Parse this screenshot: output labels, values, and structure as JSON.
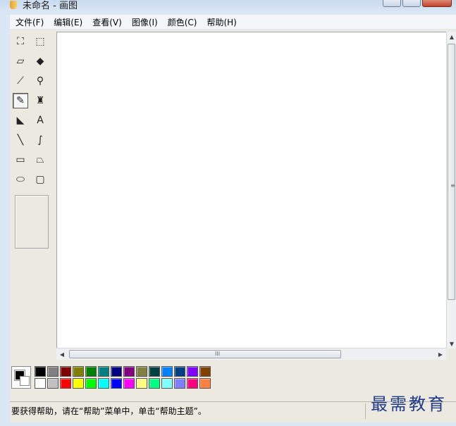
{
  "window": {
    "title": "未命名 - 画图"
  },
  "menu": [
    "文件(F)",
    "编辑(E)",
    "查看(V)",
    "图像(I)",
    "颜色(C)",
    "帮助(H)"
  ],
  "tools": [
    {
      "name": "free-form-select",
      "icon": "free-select-icon",
      "glyph": "⛶"
    },
    {
      "name": "select",
      "icon": "rect-select-icon",
      "glyph": "⬚"
    },
    {
      "name": "eraser",
      "icon": "eraser-icon",
      "glyph": "▱"
    },
    {
      "name": "fill",
      "icon": "paint-bucket-icon",
      "glyph": "◆"
    },
    {
      "name": "pick-color",
      "icon": "eyedropper-icon",
      "glyph": "⟋"
    },
    {
      "name": "magnifier",
      "icon": "magnifier-icon",
      "glyph": "⚲"
    },
    {
      "name": "pencil",
      "icon": "pencil-icon",
      "glyph": "✎",
      "selected": true
    },
    {
      "name": "brush",
      "icon": "brush-icon",
      "glyph": "♜"
    },
    {
      "name": "airbrush",
      "icon": "airbrush-icon",
      "glyph": "◣"
    },
    {
      "name": "text",
      "icon": "text-icon",
      "glyph": "A"
    },
    {
      "name": "line",
      "icon": "line-icon",
      "glyph": "╲"
    },
    {
      "name": "curve",
      "icon": "curve-icon",
      "glyph": "∫"
    },
    {
      "name": "rectangle",
      "icon": "rectangle-icon",
      "glyph": "▭"
    },
    {
      "name": "polygon",
      "icon": "polygon-icon",
      "glyph": "⏢"
    },
    {
      "name": "ellipse",
      "icon": "ellipse-icon",
      "glyph": "⬭"
    },
    {
      "name": "rounded-rectangle",
      "icon": "rounded-rect-icon",
      "glyph": "▢"
    }
  ],
  "palette": {
    "foreground": "#000000",
    "background": "#ffffff",
    "row1": [
      "#000000",
      "#808080",
      "#800000",
      "#808000",
      "#008000",
      "#008080",
      "#000080",
      "#800080",
      "#808040",
      "#004040",
      "#0080ff",
      "#004080",
      "#8000ff",
      "#804000"
    ],
    "row2": [
      "#ffffff",
      "#c0c0c0",
      "#ff0000",
      "#ffff00",
      "#00ff00",
      "#00ffff",
      "#0000ff",
      "#ff00ff",
      "#ffff80",
      "#00ff80",
      "#80ffff",
      "#8080ff",
      "#ff0080",
      "#ff8040"
    ]
  },
  "scrollbar": {
    "grip": "III"
  },
  "status": {
    "text": "要获得帮助，请在“帮助”菜单中，单击“帮助主题”。",
    "watermark": "最需教育"
  }
}
